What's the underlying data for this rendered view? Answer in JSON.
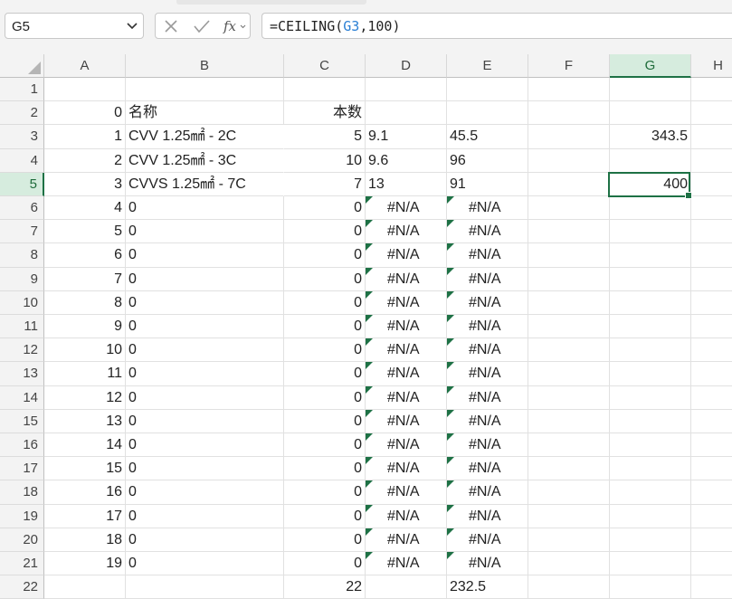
{
  "name_box": "G5",
  "formula_bar": {
    "prefix": "=CEILING(",
    "ref": "G3",
    "suffix": ",100)"
  },
  "fx_label": "fx",
  "columns": [
    "A",
    "B",
    "C",
    "D",
    "E",
    "F",
    "G",
    "H"
  ],
  "selected_column": "G",
  "selected_row": "5",
  "rows": [
    {
      "n": "1",
      "A": "",
      "B": "",
      "C": "",
      "D": "",
      "E": "",
      "G": ""
    },
    {
      "n": "2",
      "A": "0",
      "B": "名称",
      "C": "本数",
      "D": "",
      "E": "",
      "G": ""
    },
    {
      "n": "3",
      "A": "1",
      "B": "CVV 1.25㎟ - 2C",
      "C": "5",
      "D": "9.1",
      "E": "45.5",
      "G": "343.5"
    },
    {
      "n": "4",
      "A": "2",
      "B": "CVV 1.25㎟ - 3C",
      "C": "10",
      "D": "9.6",
      "E": "96",
      "G": ""
    },
    {
      "n": "5",
      "A": "3",
      "B": "CVVS 1.25㎟ - 7C",
      "C": "7",
      "D": "13",
      "E": "91",
      "G": "400"
    },
    {
      "n": "6",
      "A": "4",
      "B": "0",
      "C": "0",
      "D": "#N/A",
      "E": "#N/A",
      "G": ""
    },
    {
      "n": "7",
      "A": "5",
      "B": "0",
      "C": "0",
      "D": "#N/A",
      "E": "#N/A",
      "G": ""
    },
    {
      "n": "8",
      "A": "6",
      "B": "0",
      "C": "0",
      "D": "#N/A",
      "E": "#N/A",
      "G": ""
    },
    {
      "n": "9",
      "A": "7",
      "B": "0",
      "C": "0",
      "D": "#N/A",
      "E": "#N/A",
      "G": ""
    },
    {
      "n": "10",
      "A": "8",
      "B": "0",
      "C": "0",
      "D": "#N/A",
      "E": "#N/A",
      "G": ""
    },
    {
      "n": "11",
      "A": "9",
      "B": "0",
      "C": "0",
      "D": "#N/A",
      "E": "#N/A",
      "G": ""
    },
    {
      "n": "12",
      "A": "10",
      "B": "0",
      "C": "0",
      "D": "#N/A",
      "E": "#N/A",
      "G": ""
    },
    {
      "n": "13",
      "A": "11",
      "B": "0",
      "C": "0",
      "D": "#N/A",
      "E": "#N/A",
      "G": ""
    },
    {
      "n": "14",
      "A": "12",
      "B": "0",
      "C": "0",
      "D": "#N/A",
      "E": "#N/A",
      "G": ""
    },
    {
      "n": "15",
      "A": "13",
      "B": "0",
      "C": "0",
      "D": "#N/A",
      "E": "#N/A",
      "G": ""
    },
    {
      "n": "16",
      "A": "14",
      "B": "0",
      "C": "0",
      "D": "#N/A",
      "E": "#N/A",
      "G": ""
    },
    {
      "n": "17",
      "A": "15",
      "B": "0",
      "C": "0",
      "D": "#N/A",
      "E": "#N/A",
      "G": ""
    },
    {
      "n": "18",
      "A": "16",
      "B": "0",
      "C": "0",
      "D": "#N/A",
      "E": "#N/A",
      "G": ""
    },
    {
      "n": "19",
      "A": "17",
      "B": "0",
      "C": "0",
      "D": "#N/A",
      "E": "#N/A",
      "G": ""
    },
    {
      "n": "20",
      "A": "18",
      "B": "0",
      "C": "0",
      "D": "#N/A",
      "E": "#N/A",
      "G": ""
    },
    {
      "n": "21",
      "A": "19",
      "B": "0",
      "C": "0",
      "D": "#N/A",
      "E": "#N/A",
      "G": ""
    },
    {
      "n": "22",
      "A": "",
      "B": "",
      "C": "22",
      "D": "",
      "E": "232.5",
      "G": ""
    }
  ],
  "colors": {
    "accent": "#1e7145",
    "selected_header_bg": "#d6ecde",
    "ref_color": "#2a7fd4"
  },
  "icons": {
    "cancel": "x-icon",
    "enter": "check-icon",
    "function": "fx-icon",
    "dropdown": "chevron-down-icon"
  }
}
